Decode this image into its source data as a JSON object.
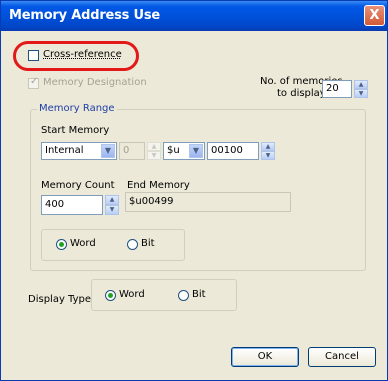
{
  "window": {
    "title": "Memory Address Use",
    "close_label": "X"
  },
  "cross_reference": {
    "label": "Cross-reference",
    "checked": false
  },
  "memory_designation": {
    "label": "Memory Designation",
    "checked": true,
    "enabled": false
  },
  "memories_to_display": {
    "label_line1": "No. of memories",
    "label_line2": "to display",
    "value": "20"
  },
  "memory_range": {
    "group_label": "Memory Range",
    "start_memory_label": "Start Memory",
    "location": "Internal",
    "number": "0",
    "prefix": "$u",
    "address": "00100",
    "memory_count_label": "Memory Count",
    "memory_count": "400",
    "end_memory_label": "End Memory",
    "end_memory": "$u00499",
    "unit_word": "Word",
    "unit_bit": "Bit",
    "unit_selected": "Word"
  },
  "display_type": {
    "label": "Display Type",
    "word": "Word",
    "bit": "Bit",
    "selected": "Word"
  },
  "buttons": {
    "ok": "OK",
    "cancel": "Cancel"
  },
  "colors": {
    "title_bar": "#0058e6",
    "highlight": "#e31919",
    "dialog_bg": "#ece9d8",
    "group_title": "#1f3ea8"
  }
}
